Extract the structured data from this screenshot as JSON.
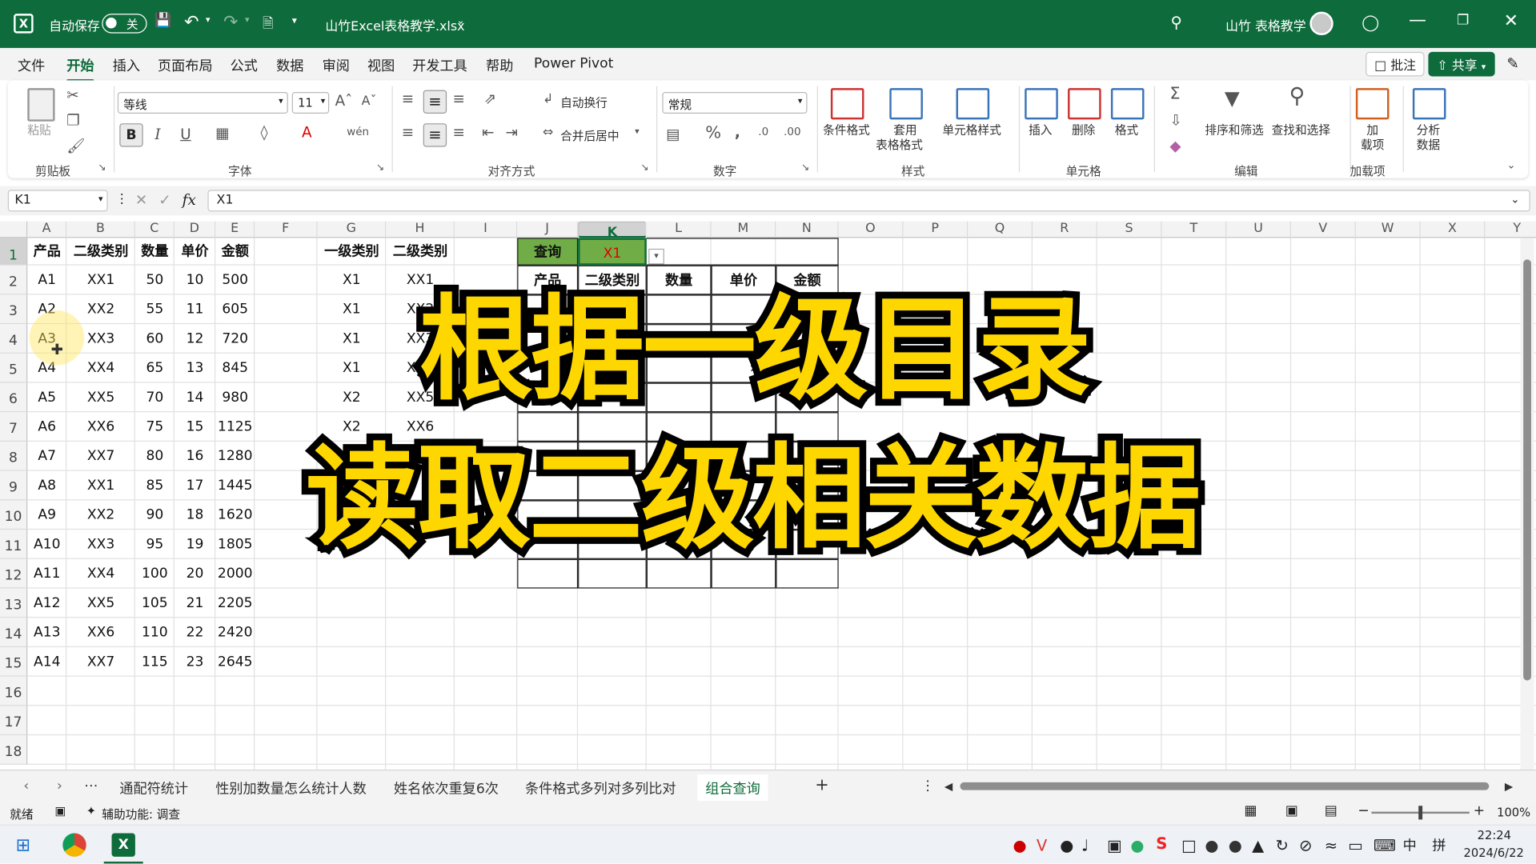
{
  "titlebar": {
    "autosave_label": "自动保存",
    "autosave_state": "关",
    "filename": "山竹Excel表格教学.xlsx",
    "user_name": "山竹 表格教学",
    "brand_color": "#0e6b3b"
  },
  "menu": {
    "tabs": [
      "文件",
      "开始",
      "插入",
      "页面布局",
      "公式",
      "数据",
      "审阅",
      "视图",
      "开发工具",
      "帮助",
      "Power Pivot"
    ],
    "active": "开始",
    "comment_label": "批注",
    "share_label": "共享"
  },
  "ribbon": {
    "clipboard": {
      "paste": "粘贴",
      "group": "剪贴板"
    },
    "font": {
      "name": "等线",
      "size": "11",
      "group": "字体"
    },
    "align": {
      "wrap": "自动换行",
      "merge": "合并后居中",
      "group": "对齐方式"
    },
    "number": {
      "format": "常规",
      "group": "数字"
    },
    "styles": {
      "cond": "条件格式",
      "table1": "套用",
      "table2": "表格格式",
      "cell": "单元格样式",
      "group": "样式"
    },
    "cells": {
      "insert": "插入",
      "delete": "删除",
      "format": "格式",
      "group": "单元格"
    },
    "edit": {
      "sort": "排序和筛选",
      "find": "查找和选择",
      "group": "编辑"
    },
    "addins": {
      "label1": "加",
      "label2": "载项",
      "group": "加载项"
    },
    "analyze": {
      "label1": "分析",
      "label2": "数据"
    }
  },
  "formula_bar": {
    "name_box": "K1",
    "fx": "fx",
    "value": "X1"
  },
  "columns": [
    "A",
    "B",
    "C",
    "D",
    "E",
    "F",
    "G",
    "H",
    "I",
    "J",
    "K",
    "L",
    "M",
    "N",
    "O",
    "P",
    "Q",
    "R",
    "S",
    "T",
    "U",
    "V",
    "W",
    "X",
    "Y"
  ],
  "rows": [
    "1",
    "2",
    "3",
    "4",
    "5",
    "6",
    "7",
    "8",
    "9",
    "10",
    "11",
    "12",
    "13",
    "14",
    "15",
    "16",
    "17",
    "18"
  ],
  "table_main": {
    "headers": [
      "产品",
      "二级类别",
      "数量",
      "单价",
      "金额"
    ],
    "rows": [
      [
        "A1",
        "XX1",
        "50",
        "10",
        "500"
      ],
      [
        "A2",
        "XX2",
        "55",
        "11",
        "605"
      ],
      [
        "A3",
        "XX3",
        "60",
        "12",
        "720"
      ],
      [
        "A4",
        "XX4",
        "65",
        "13",
        "845"
      ],
      [
        "A5",
        "XX5",
        "70",
        "14",
        "980"
      ],
      [
        "A6",
        "XX6",
        "75",
        "15",
        "1125"
      ],
      [
        "A7",
        "XX7",
        "80",
        "16",
        "1280"
      ],
      [
        "A8",
        "XX1",
        "85",
        "17",
        "1445"
      ],
      [
        "A9",
        "XX2",
        "90",
        "18",
        "1620"
      ],
      [
        "A10",
        "XX3",
        "95",
        "19",
        "1805"
      ],
      [
        "A11",
        "XX4",
        "100",
        "20",
        "2000"
      ],
      [
        "A12",
        "XX5",
        "105",
        "21",
        "2205"
      ],
      [
        "A13",
        "XX6",
        "110",
        "22",
        "2420"
      ],
      [
        "A14",
        "XX7",
        "115",
        "23",
        "2645"
      ]
    ]
  },
  "table_map": {
    "headers": [
      "一级类别",
      "二级类别"
    ],
    "rows": [
      [
        "X1",
        "XX1"
      ],
      [
        "X1",
        "XX2"
      ],
      [
        "X1",
        "XX3"
      ],
      [
        "X1",
        "XX4"
      ],
      [
        "X2",
        "XX5"
      ],
      [
        "X2",
        "XX6"
      ]
    ]
  },
  "query": {
    "label": "查询",
    "value": "X1",
    "headers": [
      "产品",
      "二级类别",
      "数量",
      "单价",
      "金额"
    ],
    "label_bg": "#70ad47",
    "value_color": "#e00000"
  },
  "overlay": {
    "line1": "根据一级目录",
    "line2": "读取二级相关数据",
    "color": "#ffd700"
  },
  "sheet_tabs": {
    "tabs": [
      "通配符统计",
      "性别加数量怎么统计人数",
      "姓名依次重复6次",
      "条件格式多列对多列比对",
      "组合查询"
    ],
    "active": "组合查询"
  },
  "status": {
    "ready": "就绪",
    "accessibility": "辅助功能: 调查",
    "zoom": "100%"
  },
  "taskbar": {
    "ime": "中",
    "ime2": "拼",
    "time": "22:24",
    "date": "2024/6/22"
  }
}
